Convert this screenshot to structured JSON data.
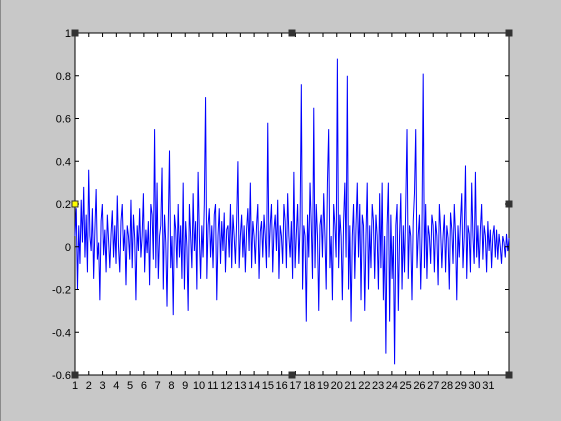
{
  "colors": {
    "figure_bg": "#c8c8c8",
    "axes_bg": "#ffffff",
    "series": "#0000ff",
    "axis": "#000000",
    "selection_handle": "#333333",
    "selected_handle_accent": "#ffff00"
  },
  "chart_data": {
    "type": "line",
    "title": "",
    "xlabel": "",
    "ylabel": "",
    "grid": false,
    "legend": "none",
    "xlim": [
      1,
      32.5
    ],
    "ylim": [
      -0.6,
      1
    ],
    "x_ticks": [
      "1",
      "2",
      "3",
      "4",
      "5",
      "6",
      "7",
      "8",
      "9",
      "10",
      "11",
      "12",
      "13",
      "14",
      "15",
      "16",
      "17",
      "18",
      "19",
      "20",
      "21",
      "22",
      "23",
      "24",
      "25",
      "26",
      "27",
      "28",
      "29",
      "30",
      "31"
    ],
    "y_ticks": [
      "-0.6",
      "-0.4",
      "-0.2",
      "0",
      "0.2",
      "0.4",
      "0.6",
      "0.8",
      "1"
    ],
    "series": [
      {
        "values": [
          0.05,
          0.18,
          -0.2,
          0.1,
          -0.08,
          0.22,
          0.02,
          0.28,
          -0.05,
          0.15,
          -0.12,
          0.36,
          0.05,
          -0.02,
          0.18,
          -0.15,
          0.08,
          0.27,
          -0.06,
          0.02,
          -0.25,
          0.12,
          0.2,
          -0.04,
          0.08,
          -0.12,
          0.15,
          0.03,
          -0.1,
          0.06,
          0.17,
          -0.05,
          0.1,
          -0.08,
          0.24,
          0.0,
          -0.12,
          0.12,
          0.2,
          -0.02,
          0.08,
          -0.18,
          0.1,
          0.05,
          -0.06,
          0.22,
          -0.1,
          0.15,
          0.04,
          -0.25,
          0.1,
          -0.02,
          0.18,
          -0.05,
          0.05,
          0.25,
          -0.12,
          0.08,
          -0.03,
          0.12,
          -0.18,
          0.2,
          0.15,
          -0.06,
          0.55,
          -0.1,
          0.3,
          -0.15,
          0.05,
          0.1,
          0.37,
          -0.2,
          0.15,
          0.02,
          -0.28,
          0.1,
          0.45,
          -0.1,
          0.05,
          -0.32,
          0.15,
          0.08,
          -0.1,
          0.2,
          -0.05,
          0.1,
          -0.15,
          0.3,
          -0.2,
          0.12,
          0.0,
          -0.3,
          0.2,
          0.05,
          -0.1,
          0.25,
          -0.02,
          0.12,
          -0.2,
          0.35,
          0.05,
          -0.15,
          0.1,
          -0.05,
          0.2,
          0.7,
          -0.15,
          0.1,
          0.18,
          -0.05,
          0.1,
          -0.1,
          0.15,
          0.2,
          -0.25,
          0.05,
          0.18,
          -0.08,
          0.12,
          -0.02,
          0.16,
          -0.12,
          0.08,
          0.1,
          -0.05,
          0.2,
          -0.1,
          0.15,
          0.05,
          -0.08,
          0.12,
          0.4,
          -0.1,
          0.05,
          0.15,
          -0.05,
          0.1,
          -0.12,
          0.08,
          0.18,
          -0.02,
          0.3,
          -0.1,
          0.12,
          0.05,
          -0.08,
          0.1,
          0.2,
          -0.15,
          0.07,
          0.12,
          -0.05,
          0.15,
          0.05,
          -0.1,
          0.58,
          -0.05,
          0.1,
          0.2,
          -0.12,
          0.08,
          0.15,
          -0.02,
          0.22,
          -0.15,
          0.1,
          0.05,
          -0.08,
          0.2,
          0.12,
          -0.1,
          0.25,
          0.05,
          -0.05,
          0.12,
          -0.15,
          0.35,
          -0.1,
          0.06,
          0.2,
          -0.08,
          0.1,
          0.76,
          -0.2,
          0.1,
          0.05,
          -0.35,
          0.15,
          -0.05,
          0.3,
          0.1,
          -0.15,
          0.65,
          -0.1,
          0.2,
          0.05,
          -0.3,
          0.1,
          0.15,
          -0.05,
          0.25,
          0.05,
          -0.2,
          0.3,
          0.55,
          -0.1,
          0.05,
          -0.25,
          0.2,
          0.1,
          -0.05,
          0.88,
          -0.1,
          0.15,
          0.05,
          -0.25,
          0.12,
          0.3,
          -0.05,
          0.8,
          -0.2,
          0.1,
          -0.35,
          0.05,
          0.2,
          -0.15,
          0.1,
          0.3,
          -0.05,
          0.2,
          -0.25,
          0.15,
          0.1,
          -0.3,
          0.05,
          0.3,
          -0.2,
          0.1,
          -0.1,
          0.2,
          0.12,
          -0.15,
          0.15,
          0.05,
          -0.2,
          0.25,
          -0.1,
          0.3,
          -0.25,
          0.05,
          -0.5,
          0.1,
          0.3,
          -0.35,
          0.15,
          -0.15,
          0.05,
          -0.55,
          0.1,
          0.2,
          -0.3,
          0.05,
          0.25,
          -0.2,
          0.1,
          -0.12,
          0.2,
          0.55,
          -0.15,
          0.1,
          0.05,
          -0.25,
          0.12,
          0.25,
          0.55,
          -0.1,
          0.05,
          0.15,
          -0.2,
          0.05,
          0.81,
          -0.1,
          0.2,
          -0.15,
          0.1,
          0.05,
          -0.08,
          0.15,
          0.1,
          -0.12,
          0.12,
          0.05,
          -0.18,
          0.2,
          0.08,
          -0.1,
          0.05,
          0.15,
          -0.12,
          0.1,
          0.04,
          -0.2,
          0.16,
          0.08,
          -0.08,
          0.2,
          0.05,
          -0.25,
          0.1,
          -0.05,
          0.12,
          0.25,
          -0.1,
          0.05,
          0.38,
          -0.15,
          0.1,
          0.06,
          -0.12,
          0.3,
          0.05,
          -0.08,
          0.35,
          -0.05,
          0.1,
          -0.1,
          0.08,
          0.2,
          -0.06,
          0.1,
          0.05,
          -0.12,
          0.12,
          -0.02,
          0.08,
          -0.1,
          0.05,
          0.1,
          -0.05,
          0.08,
          -0.06,
          0.06,
          0.0,
          -0.08,
          0.05,
          0.02,
          -0.05,
          0.06,
          -0.02,
          0.04
        ]
      }
    ]
  }
}
